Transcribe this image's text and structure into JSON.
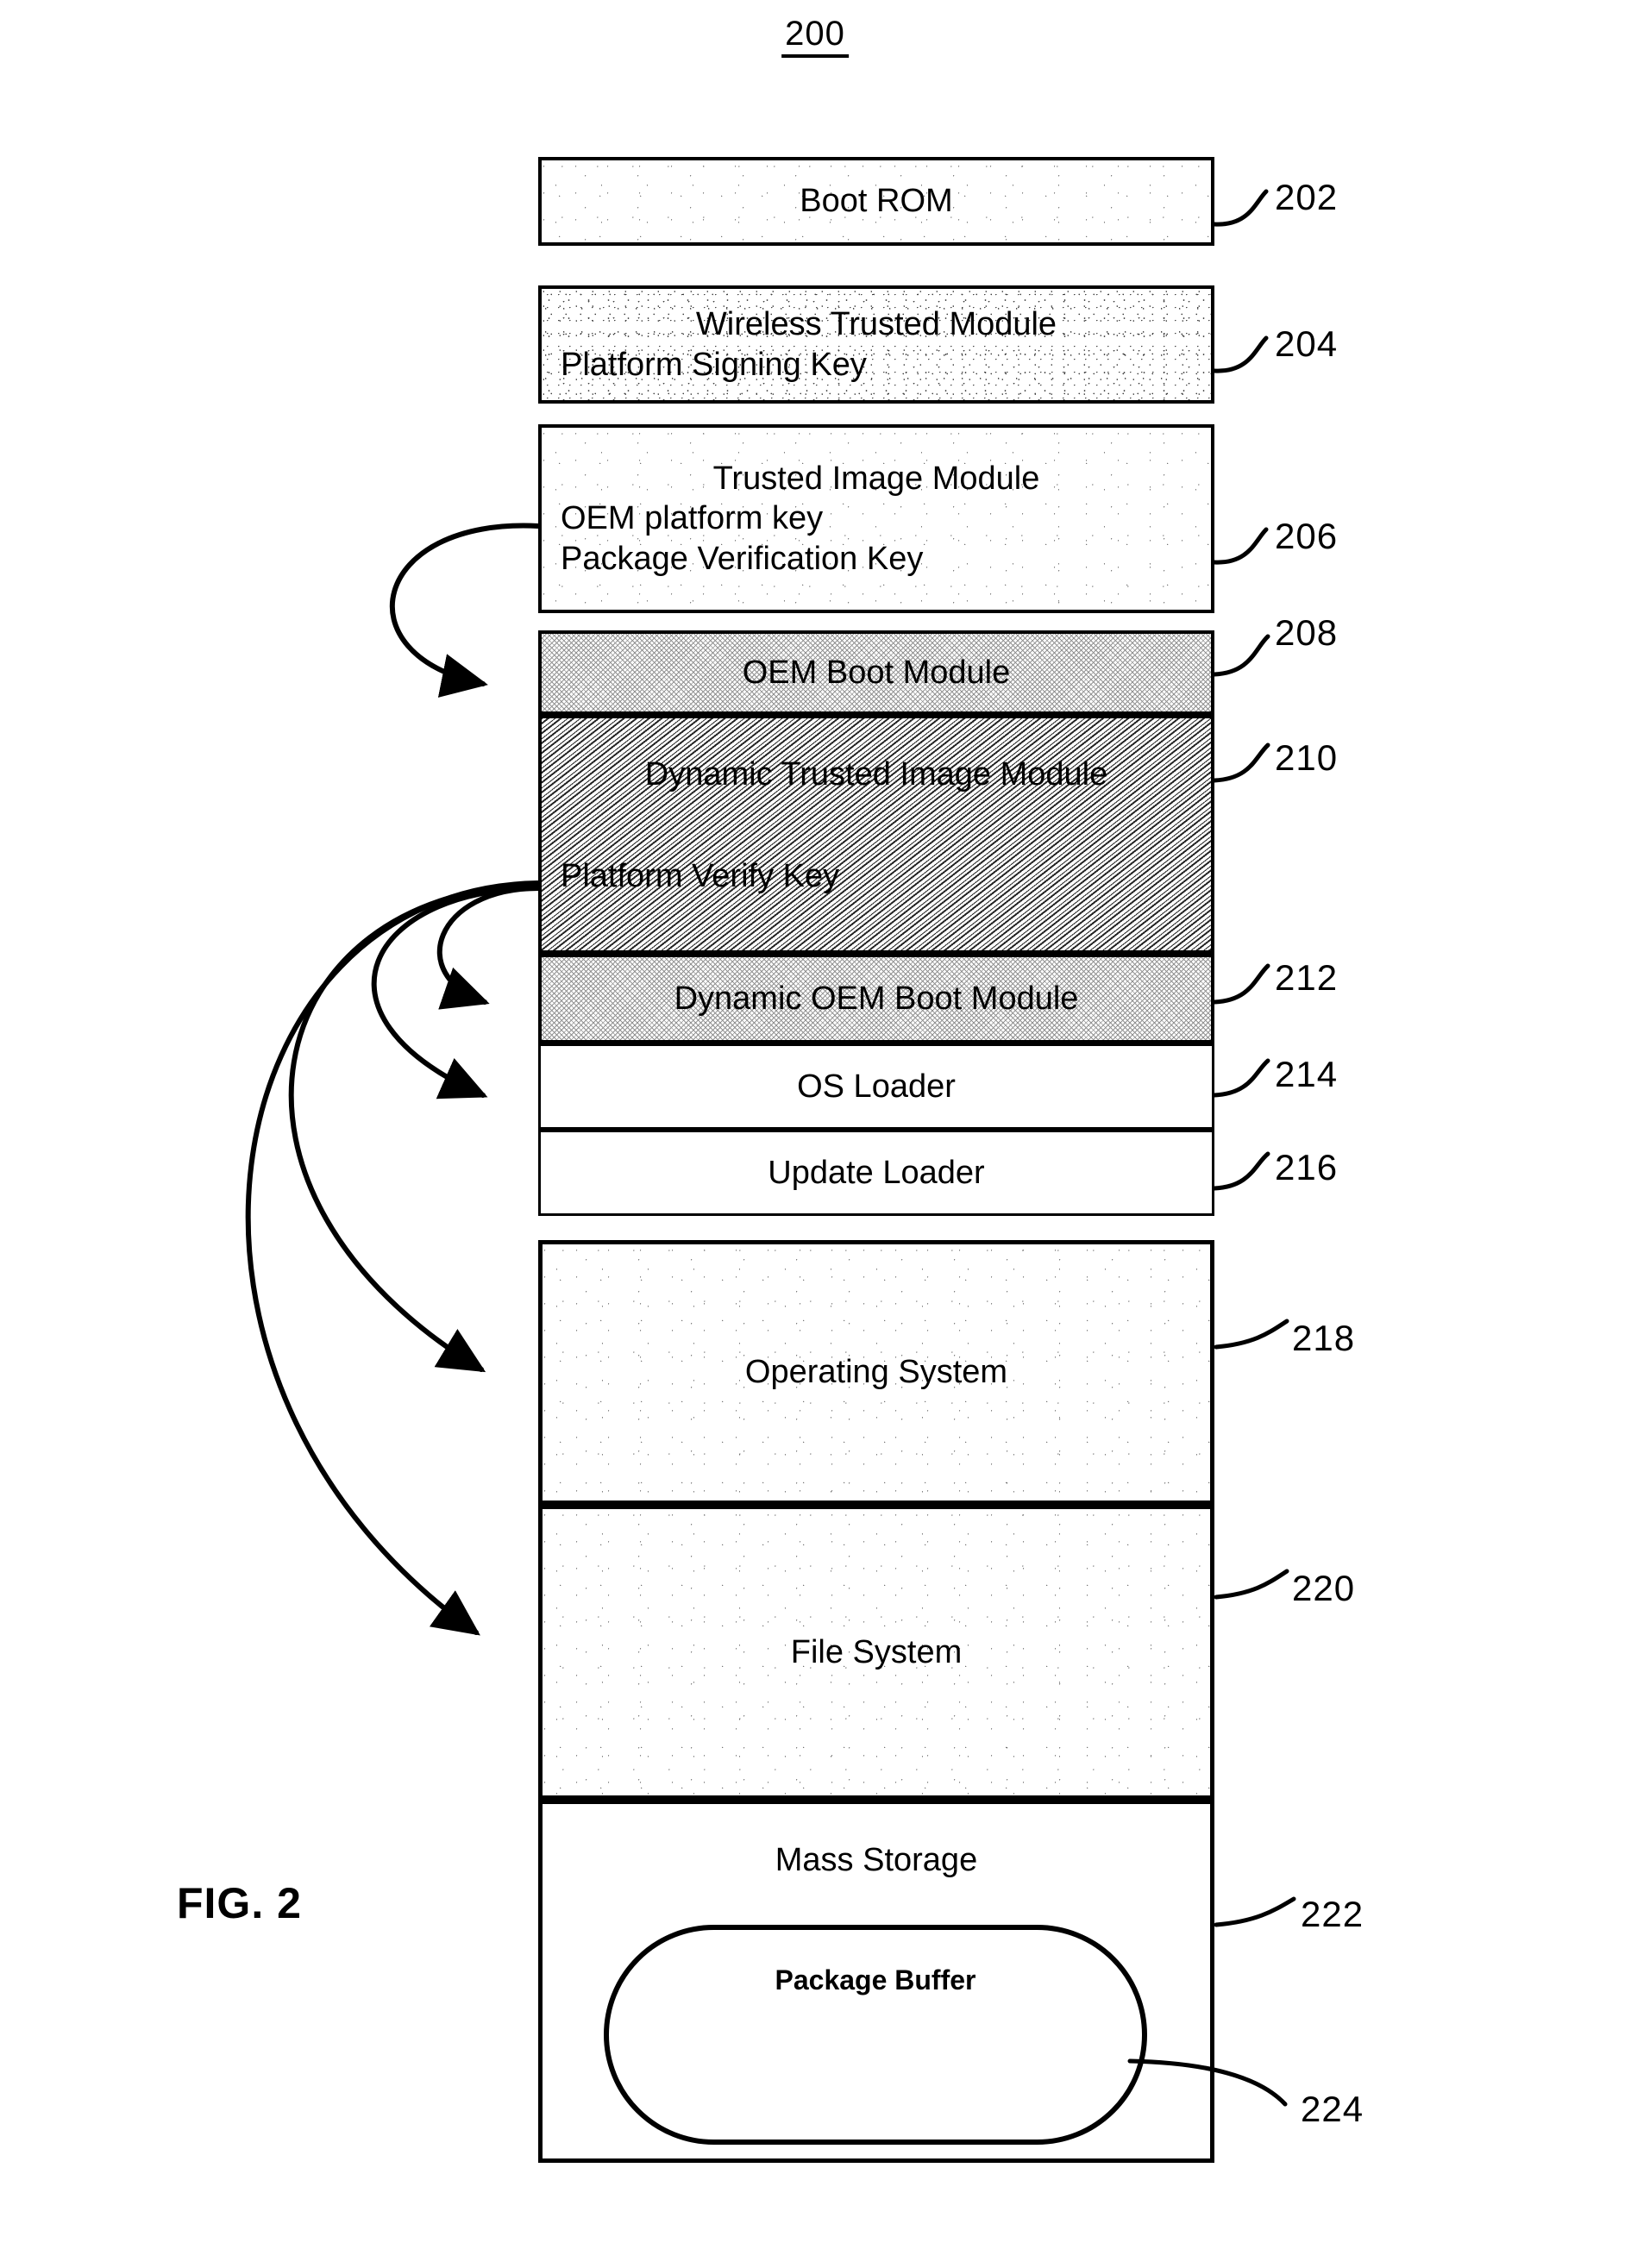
{
  "figure": {
    "number": "200",
    "caption": "FIG. 2"
  },
  "blocks": [
    {
      "ref": "202",
      "name": "boot-rom",
      "lines": [
        {
          "text": "Boot ROM",
          "align": "center"
        }
      ]
    },
    {
      "ref": "204",
      "name": "wireless-trusted-module",
      "lines": [
        {
          "text": "Wireless Trusted Module",
          "align": "center"
        },
        {
          "text": "Platform Signing Key",
          "align": "left"
        }
      ]
    },
    {
      "ref": "206",
      "name": "trusted-image-module",
      "lines": [
        {
          "text": "Trusted Image Module",
          "align": "center"
        },
        {
          "text": "OEM platform key",
          "align": "left"
        },
        {
          "text": "Package Verification Key",
          "align": "left"
        }
      ]
    },
    {
      "ref": "208",
      "name": "oem-boot-module",
      "lines": [
        {
          "text": "OEM Boot Module",
          "align": "center"
        }
      ]
    },
    {
      "ref": "210",
      "name": "dynamic-trusted-image-module",
      "lines": [
        {
          "text": "Dynamic Trusted Image Module",
          "align": "center"
        },
        {
          "text": "Platform Verify Key",
          "align": "left"
        }
      ]
    },
    {
      "ref": "212",
      "name": "dynamic-oem-boot-module",
      "lines": [
        {
          "text": "Dynamic OEM Boot Module",
          "align": "center"
        }
      ]
    },
    {
      "ref": "214",
      "name": "os-loader",
      "lines": [
        {
          "text": "OS Loader",
          "align": "center"
        }
      ]
    },
    {
      "ref": "216",
      "name": "update-loader",
      "lines": [
        {
          "text": "Update Loader",
          "align": "center"
        }
      ]
    },
    {
      "ref": "218",
      "name": "operating-system",
      "lines": [
        {
          "text": "Operating System",
          "align": "center"
        }
      ]
    },
    {
      "ref": "220",
      "name": "file-system",
      "lines": [
        {
          "text": "File System",
          "align": "center"
        }
      ]
    },
    {
      "ref": "222",
      "name": "mass-storage",
      "lines": [
        {
          "text": "Mass Storage",
          "align": "center"
        }
      ]
    }
  ],
  "package_buffer": {
    "ref": "224",
    "label": "Package Buffer"
  },
  "labels": {
    "b202_l0": "Boot ROM",
    "b204_l0": "Wireless Trusted Module",
    "b204_l1": "Platform Signing Key",
    "b206_l0": "Trusted Image Module",
    "b206_l1": "OEM platform key",
    "b206_l2": "Package Verification Key",
    "b208_l0": "OEM Boot Module",
    "b210_l0": "Dynamic Trusted Image Module",
    "b210_l1": "Platform Verify Key",
    "b212_l0": "Dynamic OEM Boot Module",
    "b214_l0": "OS Loader",
    "b216_l0": "Update Loader",
    "b218_l0": "Operating System",
    "b220_l0": "File System",
    "b222_l0": "Mass Storage",
    "pb_l0": "Package Buffer"
  },
  "refs": {
    "r202": "202",
    "r204": "204",
    "r206": "206",
    "r208": "208",
    "r210": "210",
    "r212": "212",
    "r214": "214",
    "r216": "216",
    "r218": "218",
    "r220": "220",
    "r222": "222",
    "r224": "224"
  },
  "colors": {
    "line": "#000000",
    "background": "#ffffff"
  }
}
